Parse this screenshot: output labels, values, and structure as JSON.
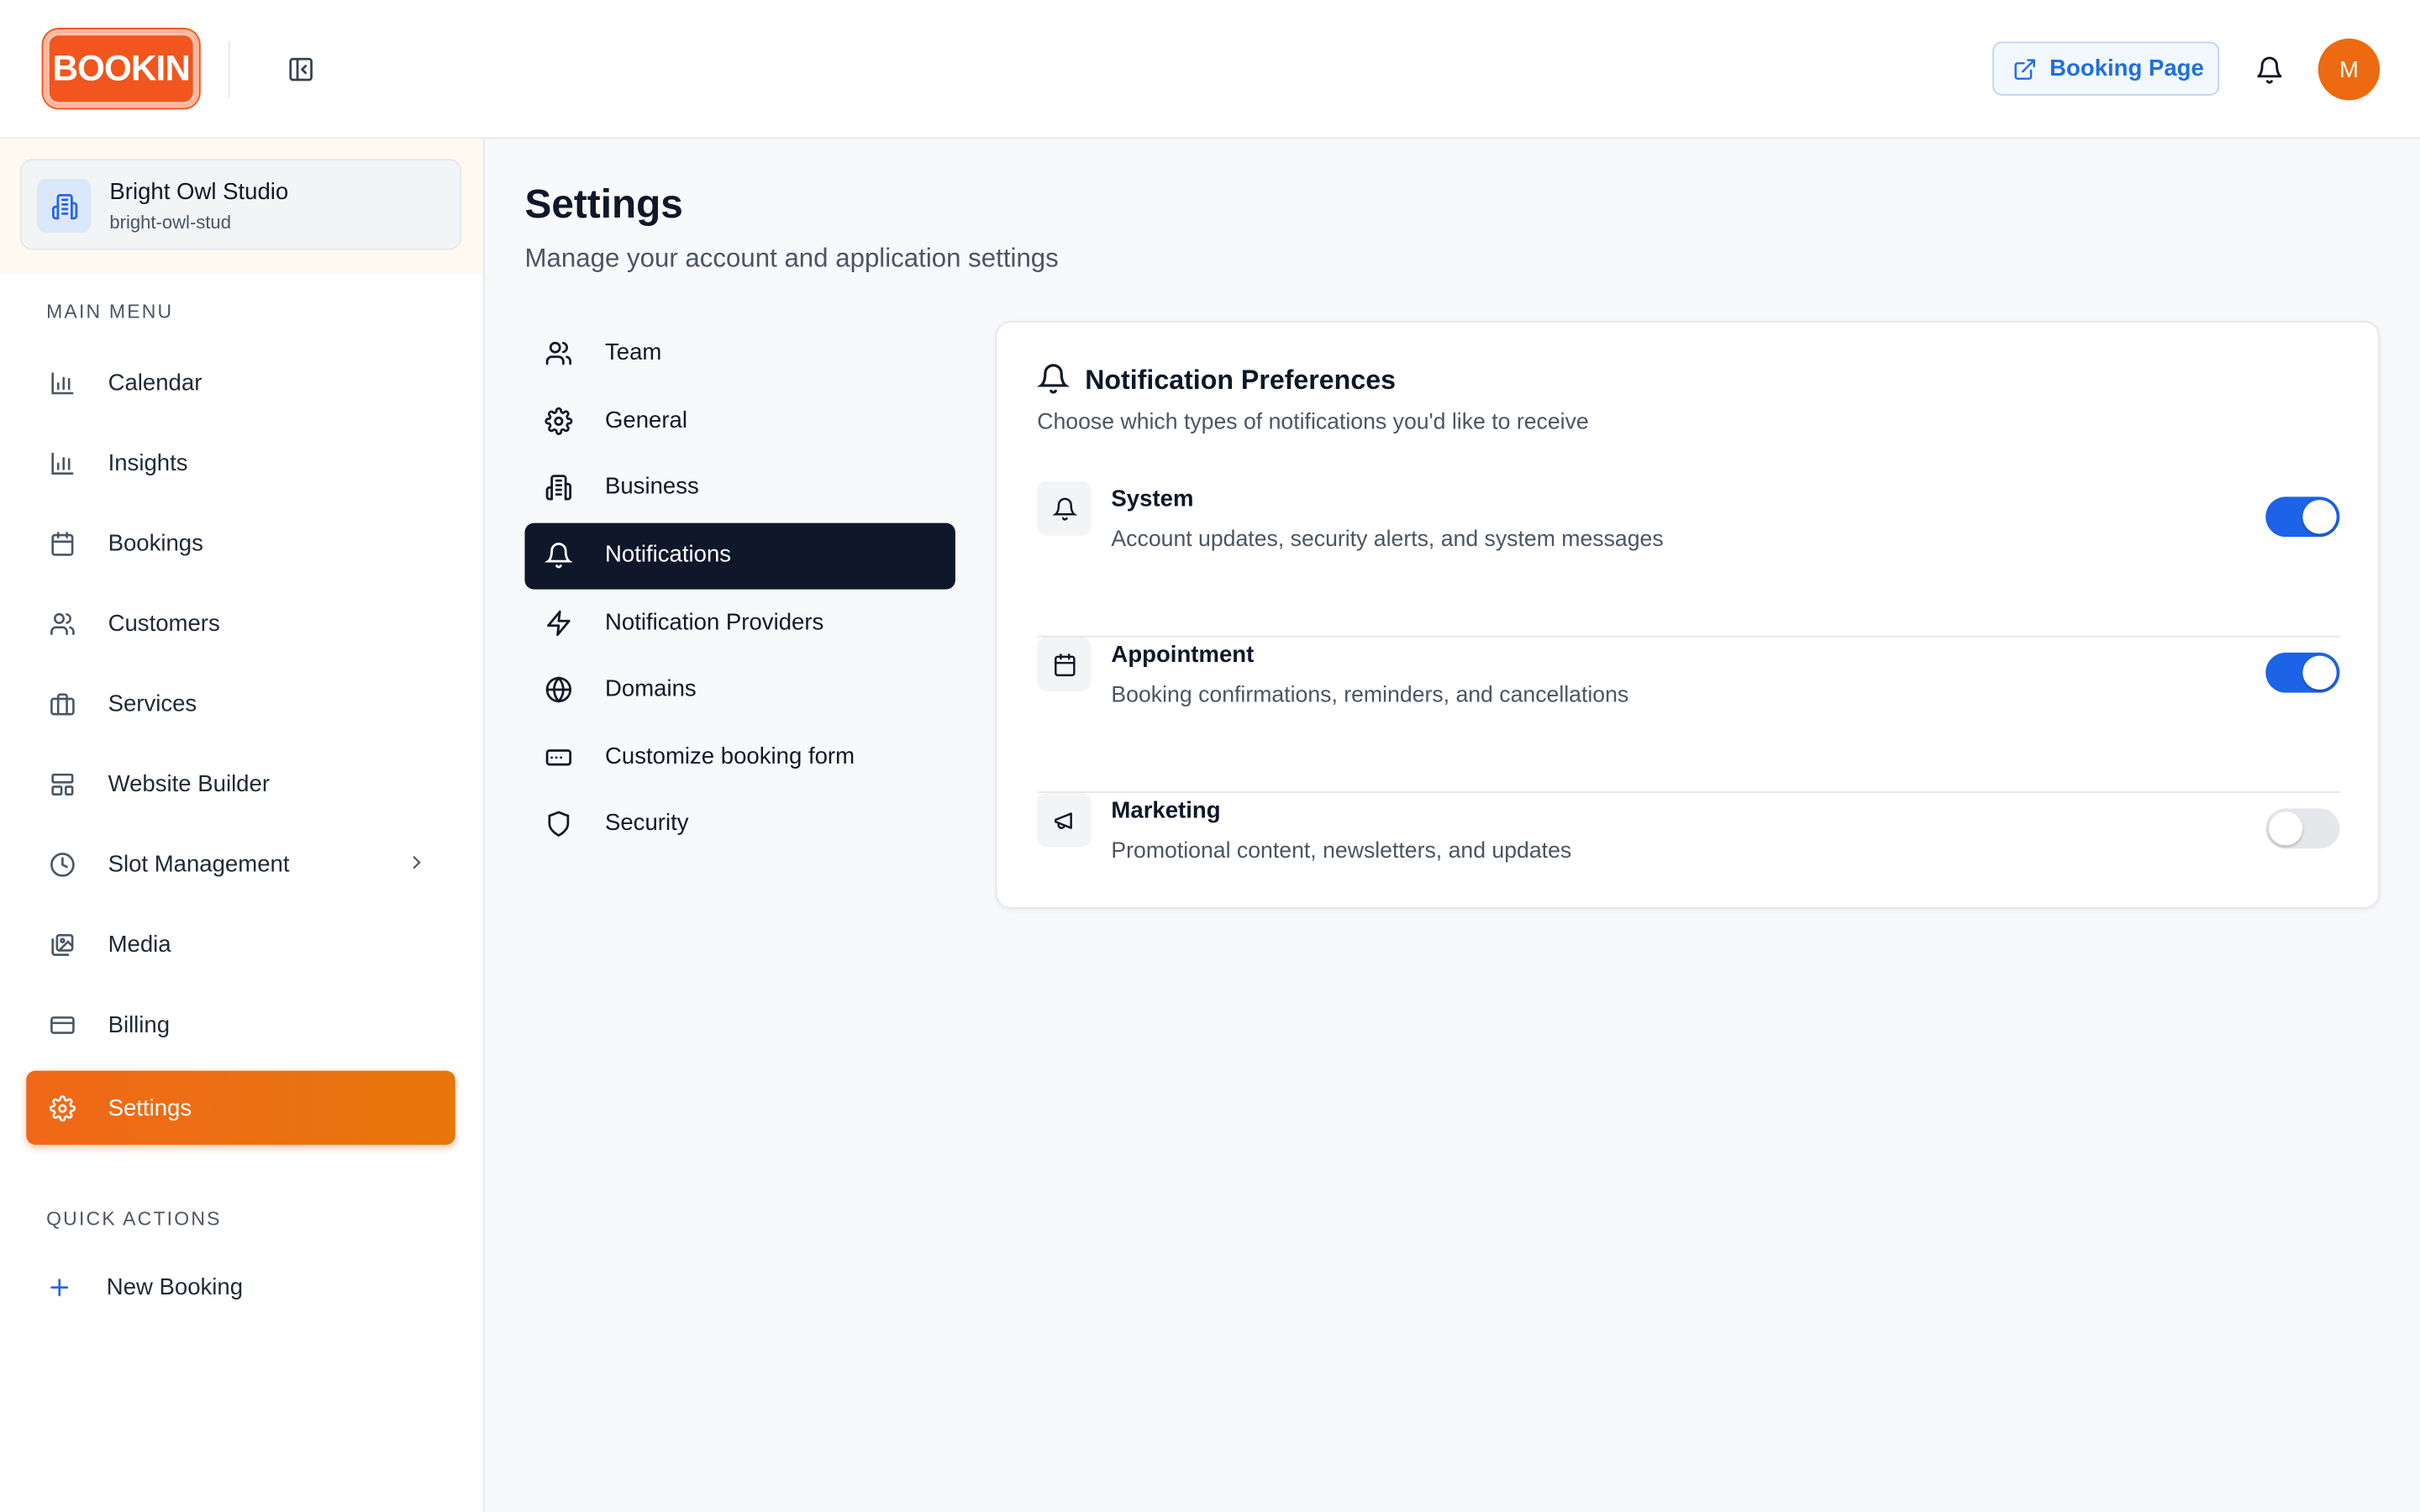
{
  "header": {
    "logo_text": "BOOKIN",
    "booking_page_label": "Booking Page",
    "avatar_initial": "M"
  },
  "org": {
    "name": "Bright Owl Studio",
    "slug": "bright-owl-stud"
  },
  "sidebar": {
    "main_menu_label": "MAIN MENU",
    "items": [
      {
        "label": "Calendar",
        "icon": "bar-chart-icon"
      },
      {
        "label": "Insights",
        "icon": "bar-chart-icon"
      },
      {
        "label": "Bookings",
        "icon": "calendar-icon"
      },
      {
        "label": "Customers",
        "icon": "users-icon"
      },
      {
        "label": "Services",
        "icon": "briefcase-icon"
      },
      {
        "label": "Website Builder",
        "icon": "layout-icon"
      },
      {
        "label": "Slot Management",
        "icon": "clock-icon"
      },
      {
        "label": "Media",
        "icon": "images-icon"
      },
      {
        "label": "Billing",
        "icon": "credit-card-icon"
      },
      {
        "label": "Settings",
        "icon": "gear-icon"
      }
    ],
    "quick_actions_label": "QUICK ACTIONS",
    "new_booking_label": "New Booking"
  },
  "main": {
    "title": "Settings",
    "subtitle": "Manage your account and application settings"
  },
  "settings_nav": [
    {
      "label": "Team",
      "icon": "users-icon"
    },
    {
      "label": "General",
      "icon": "gear-icon"
    },
    {
      "label": "Business",
      "icon": "building-icon"
    },
    {
      "label": "Notifications",
      "icon": "bell-icon"
    },
    {
      "label": "Notification Providers",
      "icon": "zap-icon"
    },
    {
      "label": "Domains",
      "icon": "globe-icon"
    },
    {
      "label": "Customize booking form",
      "icon": "form-icon"
    },
    {
      "label": "Security",
      "icon": "shield-icon"
    }
  ],
  "notifications": {
    "title": "Notification Preferences",
    "description": "Choose which types of notifications you'd like to receive",
    "prefs": [
      {
        "title": "System",
        "desc": "Account updates, security alerts, and system messages",
        "enabled": true
      },
      {
        "title": "Appointment",
        "desc": "Booking confirmations, reminders, and cancellations",
        "enabled": true
      },
      {
        "title": "Marketing",
        "desc": "Promotional content, newsletters, and updates",
        "enabled": false
      }
    ]
  },
  "colors": {
    "accent_orange": "#f06818",
    "toggle_on": "#1d63e8",
    "active_settings_nav": "#0f172a"
  }
}
